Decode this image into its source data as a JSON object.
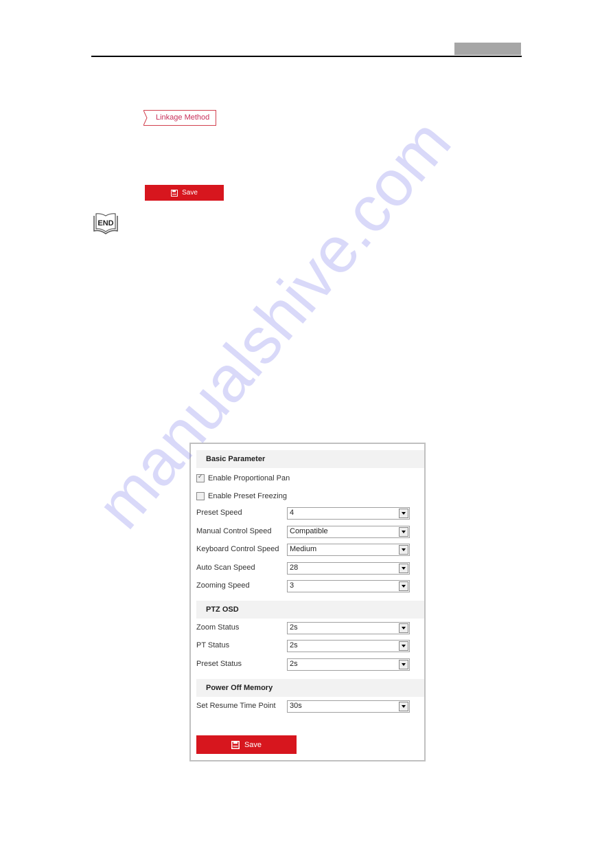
{
  "linkage_tab": {
    "label": "Linkage Method"
  },
  "save_small": {
    "label": "Save",
    "icon": "floppy-disk-icon"
  },
  "end_badge": {
    "label": "END",
    "icon": "open-book-icon"
  },
  "watermark": {
    "text": "manualshive.com"
  },
  "form": {
    "sections": {
      "basic": {
        "title": "Basic Parameter"
      },
      "ptz_osd": {
        "title": "PTZ OSD"
      },
      "power_off": {
        "title": "Power Off Memory"
      }
    },
    "checkboxes": [
      {
        "label": "Enable Proportional Pan",
        "checked": true
      },
      {
        "label": "Enable Preset Freezing",
        "checked": false
      }
    ],
    "basic_fields": [
      {
        "label": "Preset Speed",
        "value": "4"
      },
      {
        "label": "Manual Control Speed",
        "value": "Compatible"
      },
      {
        "label": "Keyboard Control Speed",
        "value": "Medium"
      },
      {
        "label": "Auto Scan Speed",
        "value": "28"
      },
      {
        "label": "Zooming Speed",
        "value": "3"
      }
    ],
    "osd_fields": [
      {
        "label": "Zoom Status",
        "value": "2s"
      },
      {
        "label": "PT Status",
        "value": "2s"
      },
      {
        "label": "Preset Status",
        "value": "2s"
      }
    ],
    "power_fields": [
      {
        "label": "Set Resume Time Point",
        "value": "30s"
      }
    ],
    "save": {
      "label": "Save",
      "icon": "floppy-disk-icon"
    }
  },
  "colors": {
    "accent_red": "#d7161e",
    "tab_text": "#c8305a",
    "section_bg": "#f2f2f2"
  }
}
